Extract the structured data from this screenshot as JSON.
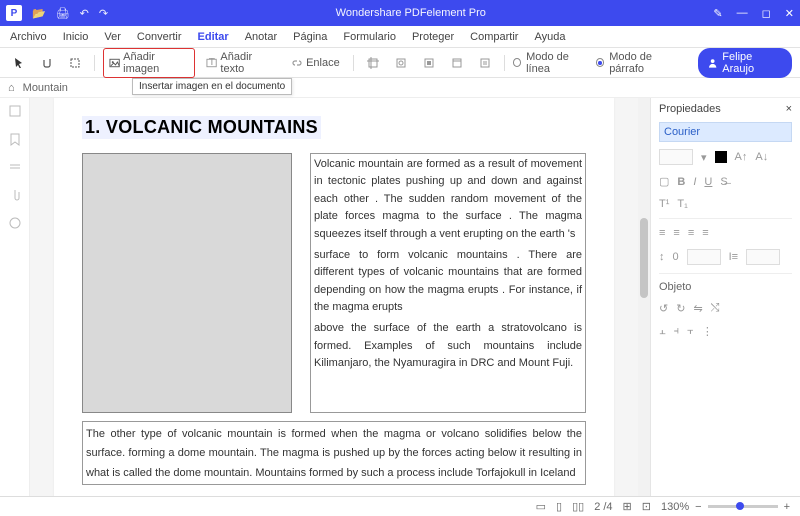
{
  "app": {
    "title": "Wondershare PDFelement Pro"
  },
  "menu": {
    "items": [
      "Archivo",
      "Inicio",
      "Ver",
      "Convertir",
      "Editar",
      "Anotar",
      "Página",
      "Formulario",
      "Proteger",
      "Compartir",
      "Ayuda"
    ],
    "active": 4
  },
  "toolbar": {
    "add_image": "Añadir imagen",
    "add_text": "Añadir texto",
    "link": "Enlace",
    "line_mode": "Modo de línea",
    "para_mode": "Modo de párrafo",
    "tooltip": "Insertar imagen en el documento"
  },
  "user": {
    "name": "Felipe Araujo"
  },
  "breadcrumb": {
    "doc": "Mountain"
  },
  "doc": {
    "heading": "1. VOLCANIC MOUNTAINS",
    "p1": "Volcanic mountain are formed as a result of movement in tectonic plates pushing up and down and against each other . The sudden random movement of the plate forces magma to the surface . The magma squeezes itself through a vent erupting on the earth 's",
    "p2": "surface to form volcanic mountains . There are different types of volcanic mountains that are formed depending on how the magma erupts . For instance, if the magma erupts",
    "p3": "above the surface of the earth a stratovolcano is formed. Examples of such mountains include Kilimanjaro, the Nyamuragira in DRC and Mount Fuji.",
    "p4": "The other type of volcanic mountain is formed when the magma or volcano solidifies below the surface. forming a dome mountain. The magma is pushed up by the forces acting below it resulting in what is called the dome mountain. Mountains formed by such a process include Torfajokull in Iceland"
  },
  "panel": {
    "title": "Propiedades",
    "font": "Courier",
    "spacing": "0",
    "object": "Objeto"
  },
  "status": {
    "page": "2 /4",
    "zoom": "130%"
  }
}
